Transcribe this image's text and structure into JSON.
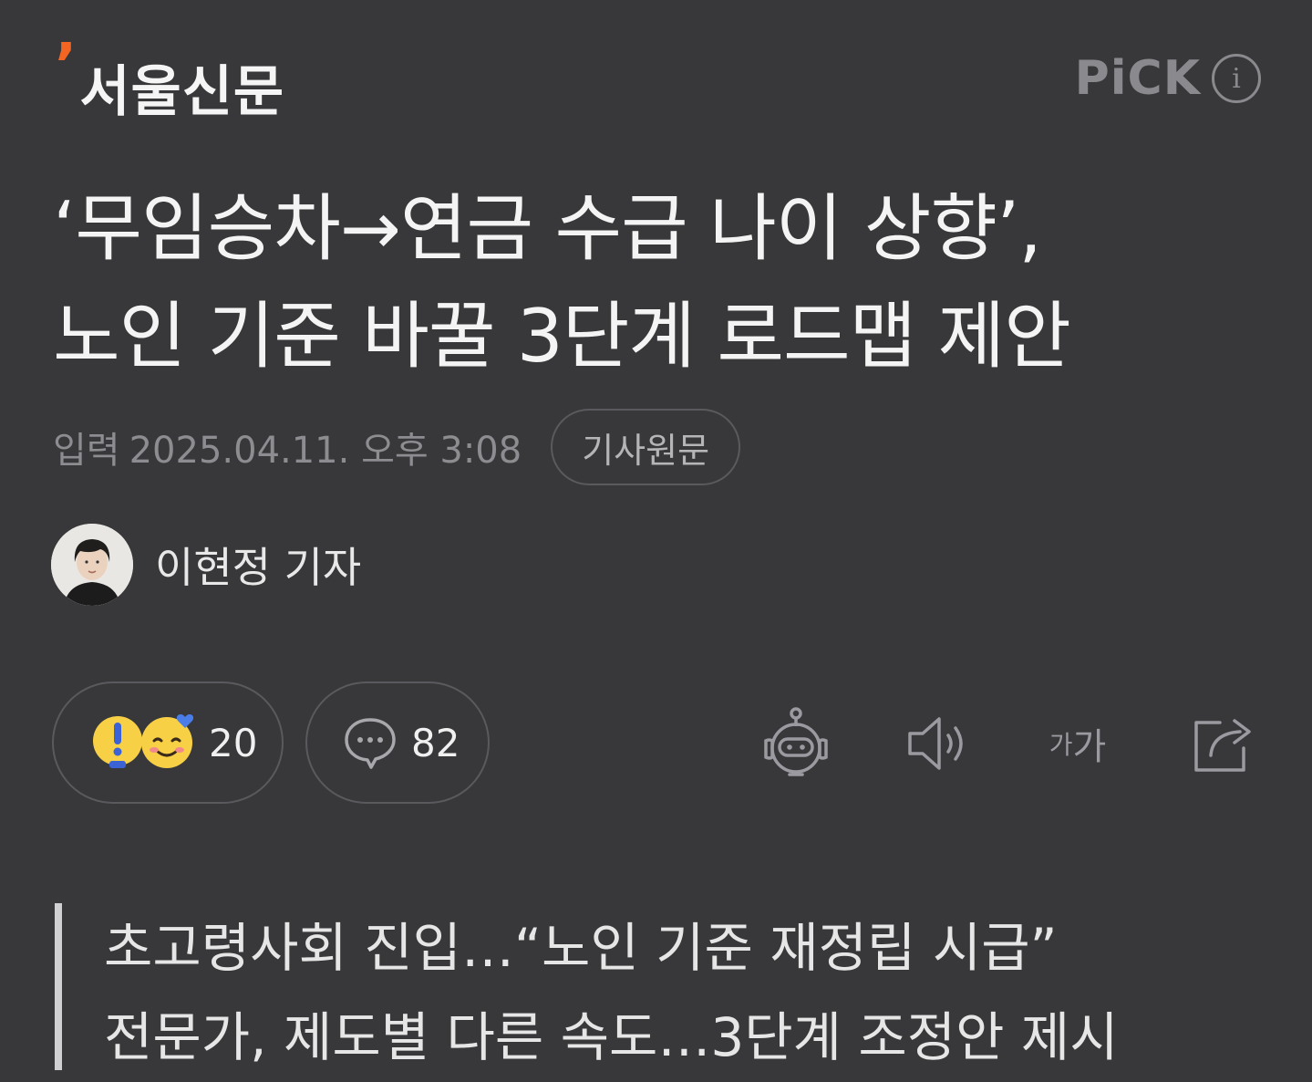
{
  "header": {
    "logo_text": "서울신문",
    "logo_mark": "’",
    "pick_label": "PiCK",
    "info_icon": "info-icon"
  },
  "article": {
    "title_line1": "‘무임승차→연금 수급 나이 상향’,",
    "title_line2": "노인 기준 바꿀 3단계 로드맵 제안",
    "date_label": "입력",
    "date_value": "2025.04.11. 오후 3:08",
    "original_button": "기사원문",
    "author": "이현정 기자"
  },
  "actions": {
    "reaction_count": "20",
    "comment_count": "82",
    "font_small": "가",
    "font_large": "가"
  },
  "summary": {
    "line1": "초고령사회 진입…“노인 기준 재정립 시급”",
    "line2": "전문가, 제도별 다른 속도…3단계 조정안 제시"
  },
  "colors": {
    "background": "#38383a",
    "logo_accent": "#f26522",
    "muted": "#8d8d91"
  }
}
